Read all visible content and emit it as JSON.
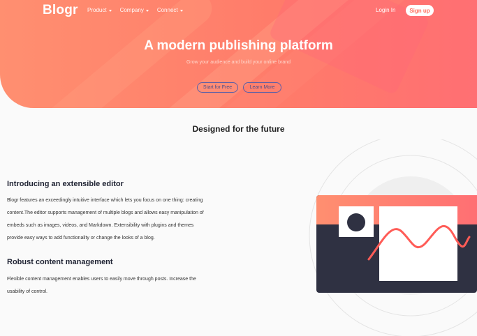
{
  "nav": {
    "logo": "Blogr",
    "links": [
      {
        "label": "Product"
      },
      {
        "label": "Company"
      },
      {
        "label": "Connect"
      }
    ],
    "login": "Login In",
    "signup": "Sign up"
  },
  "hero": {
    "title": "A modern publishing platform",
    "subtitle": "Grow your audience and build your online brand",
    "cta_primary": "Start for Free",
    "cta_secondary": "Learn More"
  },
  "section": {
    "title": "Designed for the future",
    "blocks": [
      {
        "heading": "Introducing an extensible editor",
        "lines": [
          "Blogr features an exceedingly intuitive interface which lets you focus on one thing: creating",
          "content.The editor supports management of multiple blogs and allows easy manipulation of",
          "embeds such as images, videos, and Markdown. Extensibility with plugins and themes",
          "provide easy ways to add functionality or change the looks of a blog."
        ]
      },
      {
        "heading": "Robust content management",
        "lines": [
          "Flexible content management enables users to easily move through posts. Increase the",
          "usability of control."
        ]
      }
    ]
  },
  "colors": {
    "hero_start": "#ff8f70",
    "hero_end": "#ff6f73",
    "dark": "#2f3142",
    "wave": "#ff5c57"
  }
}
